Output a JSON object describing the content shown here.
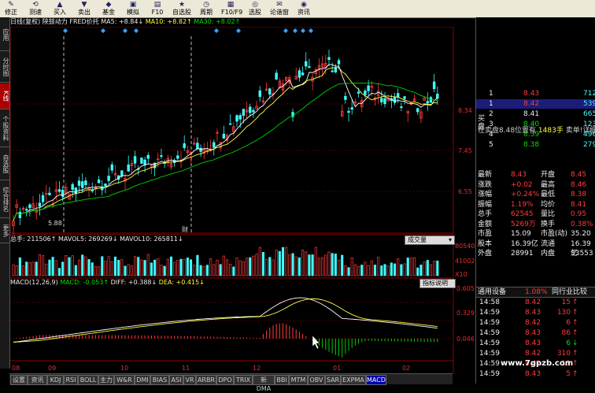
{
  "toolbar": {
    "buttons": [
      {
        "icon": "✎",
        "label": "修正"
      },
      {
        "icon": "⟲",
        "label": "测速"
      },
      {
        "icon": "▲",
        "label": "买入"
      },
      {
        "icon": "▼",
        "label": "卖出"
      },
      {
        "icon": "◆",
        "label": "基金"
      },
      {
        "icon": "▣",
        "label": "模拟"
      },
      {
        "icon": "▤",
        "label": "F10"
      },
      {
        "icon": "★",
        "label": "自选股"
      },
      {
        "icon": "◷",
        "label": "周期"
      },
      {
        "icon": "▦",
        "label": "F10/F9"
      },
      {
        "icon": "◎",
        "label": "选股"
      },
      {
        "icon": "✉",
        "label": "论谐窗"
      },
      {
        "icon": "◉",
        "label": "资讯"
      }
    ]
  },
  "left_tabs": [
    {
      "label": "应用"
    },
    {
      "label": "分时图"
    },
    {
      "label": "K线"
    },
    {
      "label": "个股资料"
    },
    {
      "label": "自选股"
    },
    {
      "label": "综合排名"
    },
    {
      "label": "更多"
    }
  ],
  "kline_info": {
    "period": "日线(复权)",
    "stock": "陕鼓动力",
    "indicator": "FRED价托",
    "ma5": "MA5: +8.84↓",
    "ma10": "MA10: +8.82↑",
    "ma30": "MA30: +8.02↑"
  },
  "price_axis": [
    "8.34",
    "7.45",
    "6.55"
  ],
  "kline_annotations": {
    "low": "5.88",
    "tag": "财"
  },
  "volume_info": {
    "total": "总手: 211506↑",
    "mavol5": "MAVOL5: 269269↓",
    "mavol10": "MAVOL10: 265811↓",
    "dropdown": "成交量"
  },
  "volume_axis": [
    "80540",
    "41002",
    "X10"
  ],
  "macd_info": {
    "title": "MACD(12,26,9)",
    "macd": "MACD: -0.053↑",
    "diff": "DIFF: +0.388↓",
    "dea": "DEA: +0.415↓",
    "button": "指标说明"
  },
  "macd_axis": [
    "0.605",
    "0.329",
    "0.046"
  ],
  "date_axis": [
    {
      "label": "08"
    },
    {
      "label": "09"
    },
    {
      "label": "10"
    },
    {
      "label": "11"
    },
    {
      "label": "12"
    },
    {
      "label": "01"
    },
    {
      "label": "02"
    }
  ],
  "bottom_tabs": [
    "设置",
    "资讯",
    "KDJ",
    "RSI",
    "BOLL",
    "主力",
    "W&R",
    "DMI",
    "BIAS",
    "ASI",
    "VR",
    "ARBR",
    "DPO",
    "TRIX",
    "新DMA",
    "BBI",
    "MTM",
    "OBV",
    "SAR",
    "EXPMA",
    "MACD"
  ],
  "active_bottom_tab": "MACD",
  "orderbook": {
    "sell_label": "卖",
    "buy_label": "买盘",
    "rows": [
      {
        "num": "1",
        "price": "8.43",
        "vol": "712"
      },
      {
        "num": "1",
        "price": "8.42",
        "vol": "539"
      },
      {
        "num": "2",
        "price": "8.41",
        "vol": "665"
      },
      {
        "num": "3",
        "price": "8.40",
        "vol": "1233"
      },
      {
        "num": "4",
        "price": "8.39",
        "vol": "496"
      },
      {
        "num": "5",
        "price": "8.38",
        "vol": "279"
      }
    ],
    "summary_left": "在卖盘8.48位置有",
    "summary_mid": "1483手",
    "summary_right": "卖单!详细"
  },
  "quote": [
    {
      "k1": "最新",
      "v1": "8.43",
      "k2": "开盘",
      "v2": "8.45"
    },
    {
      "k1": "涨跌",
      "v1": "+0.02",
      "k2": "最高",
      "v2": "8.46"
    },
    {
      "k1": "涨幅",
      "v1": "+0.24%",
      "k2": "最低",
      "v2": "8.38"
    },
    {
      "k1": "振幅",
      "v1": "1.19%",
      "k2": "均价",
      "v2": "8.41"
    },
    {
      "k1": "总手",
      "v1": "62545",
      "k2": "量比",
      "v2": "0.95"
    },
    {
      "k1": "金额",
      "v1": "5269万",
      "k2": "换手",
      "v2": "0.38%"
    },
    {
      "k1": "市盈",
      "v1": "15.09",
      "k2": "市盈(动)",
      "v2": "35.20"
    },
    {
      "k1": "股本",
      "v1": "16.39亿",
      "k2": "流通",
      "v2": "16.39亿"
    },
    {
      "k1": "外盘",
      "v1": "28991",
      "k2": "内盘",
      "v2": "33553"
    }
  ],
  "tabs2": {
    "left": "通用设备",
    "pct": "1.08%",
    "right": "同行业比较"
  },
  "trades": [
    {
      "time": "14:58",
      "price": "8.42",
      "vol": "15",
      "dir": "up"
    },
    {
      "time": "14:59",
      "price": "8.43",
      "vol": "130",
      "dir": "up"
    },
    {
      "time": "14:59",
      "price": "8.42",
      "vol": "6",
      "dir": "up"
    },
    {
      "time": "14:59",
      "price": "8.43",
      "vol": "86",
      "dir": "up"
    },
    {
      "time": "14:59",
      "price": "8.43",
      "vol": "6",
      "dir": "down"
    },
    {
      "time": "14:59",
      "price": "8.42",
      "vol": "310",
      "dir": "up"
    },
    {
      "time": "14:59",
      "price": "8.42",
      "vol": "13",
      "dir": "up"
    },
    {
      "time": "14:59",
      "price": "8.43",
      "vol": "5",
      "dir": "up"
    }
  ],
  "watermark": "www.7gpzb.com",
  "colors": {
    "up": "#ff3b3b",
    "down": "#40ffff",
    "ma5": "#ffffff",
    "ma10": "#ffff40",
    "ma30": "#00d000",
    "grid": "#8b0000"
  }
}
